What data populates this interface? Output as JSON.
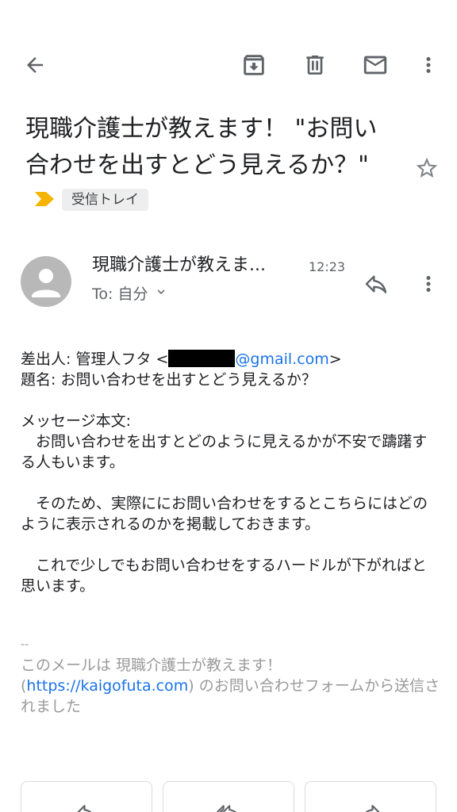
{
  "toolbar": {
    "back_icon": "arrow-back-icon",
    "archive_icon": "archive-icon",
    "delete_icon": "trash-icon",
    "unread_icon": "mail-icon",
    "more_icon": "more-vert-icon"
  },
  "subject": {
    "text": "現職介護士が教えます！ \"お問い合わせを出すとどう見えるか？\"",
    "importance_color": "#f4b400",
    "label": "受信トレイ",
    "star_icon": "star-outline-icon"
  },
  "message": {
    "sender_name": "現職介護士が教えま...",
    "time": "12:23",
    "recipient": "To: 自分",
    "reply_icon": "reply-icon",
    "body": {
      "from_prefix": "差出人: 管理人フタ <",
      "from_email_domain": "@gmail.com",
      "from_suffix": ">",
      "subject_line": "題名: お問い合わせを出すとどう見えるか？",
      "message_heading": "メッセージ本文:",
      "para1": "　お問い合わせを出すとどのように見えるかが不安で躊躇する人もいます。",
      "para2": "　そのため、実際ににお問い合わせをするとこちらにはどのように表示されるのかを掲載しておきます。",
      "para3": "　これで少しでもお問い合わせをするハードルが下がればと思います。"
    },
    "signature": {
      "separator": "--",
      "line1": "このメールは 現職介護士が教えます！",
      "open_paren": "(",
      "link": "https://kaigofuta.com",
      "line2_rest": ") のお問い合わせフォームから送信されました"
    }
  },
  "bottom_actions": [
    {
      "icon": "reply-icon"
    },
    {
      "icon": "reply-all-icon"
    },
    {
      "icon": "forward-icon"
    }
  ],
  "colors": {
    "link": "#1a73e8",
    "avatar_bg": "#b8b8b8",
    "chip_bg": "#eeeeee"
  }
}
